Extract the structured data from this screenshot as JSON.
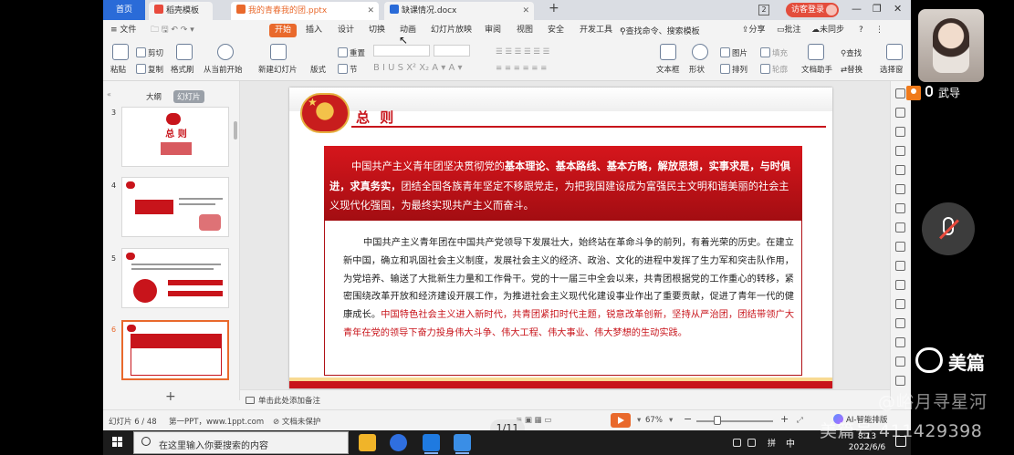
{
  "tabs": {
    "home": "首页",
    "items": [
      {
        "label": "稻壳模板",
        "color": "#e84a3c"
      },
      {
        "label": "我的青春我的团.pptx",
        "color": "#e9692c"
      },
      {
        "label": "缺课情况.docx",
        "color": "#2a6bd8"
      }
    ],
    "add": "+",
    "window_count": "2",
    "guest_login": "访客登录"
  },
  "menu": {
    "file": "≡ 文件",
    "items": [
      "开始",
      "插入",
      "设计",
      "切换",
      "动画",
      "幻灯片放映",
      "审阅",
      "视图",
      "安全",
      "开发工具"
    ],
    "active": "开始",
    "search": "查找命令、搜索模板",
    "right": [
      "分享",
      "批注",
      "未同步"
    ]
  },
  "ribbon": {
    "paste": "粘贴",
    "cut": "剪切",
    "copy": "复制",
    "format_painter": "格式刷",
    "from_current": "从当前开始",
    "new_slide": "新建幻灯片",
    "layout": "版式",
    "reset": "重置",
    "section": "节",
    "text_box": "文本框",
    "shape": "形状",
    "picture": "图片",
    "arrange": "排列",
    "fill": "填充",
    "outline": "轮廓",
    "doc_assistant": "文档助手",
    "find": "查找",
    "replace": "替换",
    "select": "选择窗"
  },
  "left_pane": {
    "outline_tab": "大纲",
    "slides_tab": "幻灯片",
    "thumbs": [
      {
        "num": "3",
        "title": "总 则"
      },
      {
        "num": "4",
        "title": ""
      },
      {
        "num": "5",
        "title": ""
      },
      {
        "num": "6",
        "title": ""
      }
    ],
    "add": "+"
  },
  "slide": {
    "title": "总 则",
    "red_box": {
      "pre": "中国共产主义青年团坚决贯彻党的",
      "b1": "基本理论、基本路线、基本方略，解放思想，实事求是，与时俱进，求真务实，",
      "post": "团结全国各族青年坚定不移跟党走，为把我国建设成为富强民主文明和谐美丽的社会主义现代化强国，为最终实现共产主义而奋斗。"
    },
    "body_black": "中国共产主义青年团在中国共产党领导下发展壮大，始终站在革命斗争的前列，有着光荣的历史。在建立新中国，确立和巩固社会主义制度，发展社会主义的经济、政治、文化的进程中发挥了生力军和突击队作用，为党培养、输送了大批新生力量和工作骨干。党的十一届三中全会以来，共青团根据党的工作重心的转移，紧密围绕改革开放和经济建设开展工作，为推进社会主义现代化建设事业作出了重要贡献，促进了青年一代的健康成长。",
    "body_red": "中国特色社会主义进入新时代，共青团紧扣时代主题，锐意改革创新，坚持从严治团，团结带领广大青年在党的领导下奋力投身伟大斗争、伟大工程、伟大事业、伟大梦想的生动实践。"
  },
  "notes_placeholder": "单击此处添加备注",
  "status": {
    "slide_pos": "幻灯片 6 / 48",
    "theme": "第一PPT，www.1ppt.com",
    "protect": "文档未保护",
    "zoom": "67%",
    "minus": "−",
    "plus": "+",
    "ai": "AI-智能排版"
  },
  "page_overlay": "1/11",
  "taskbar": {
    "search": "在这里输入你要搜索的内容",
    "ime": "拼",
    "lang": "中",
    "time": "8:13",
    "date": "2022/6/6"
  },
  "call": {
    "speaker": "武导",
    "brand": "美篇"
  },
  "watermark": {
    "line1": "@峪月寻星河",
    "line2": "美篇号 411429398"
  },
  "colors": {
    "accent": "#e9692c",
    "slide_red": "#c8141b",
    "home_tab": "#2a6bd8"
  }
}
